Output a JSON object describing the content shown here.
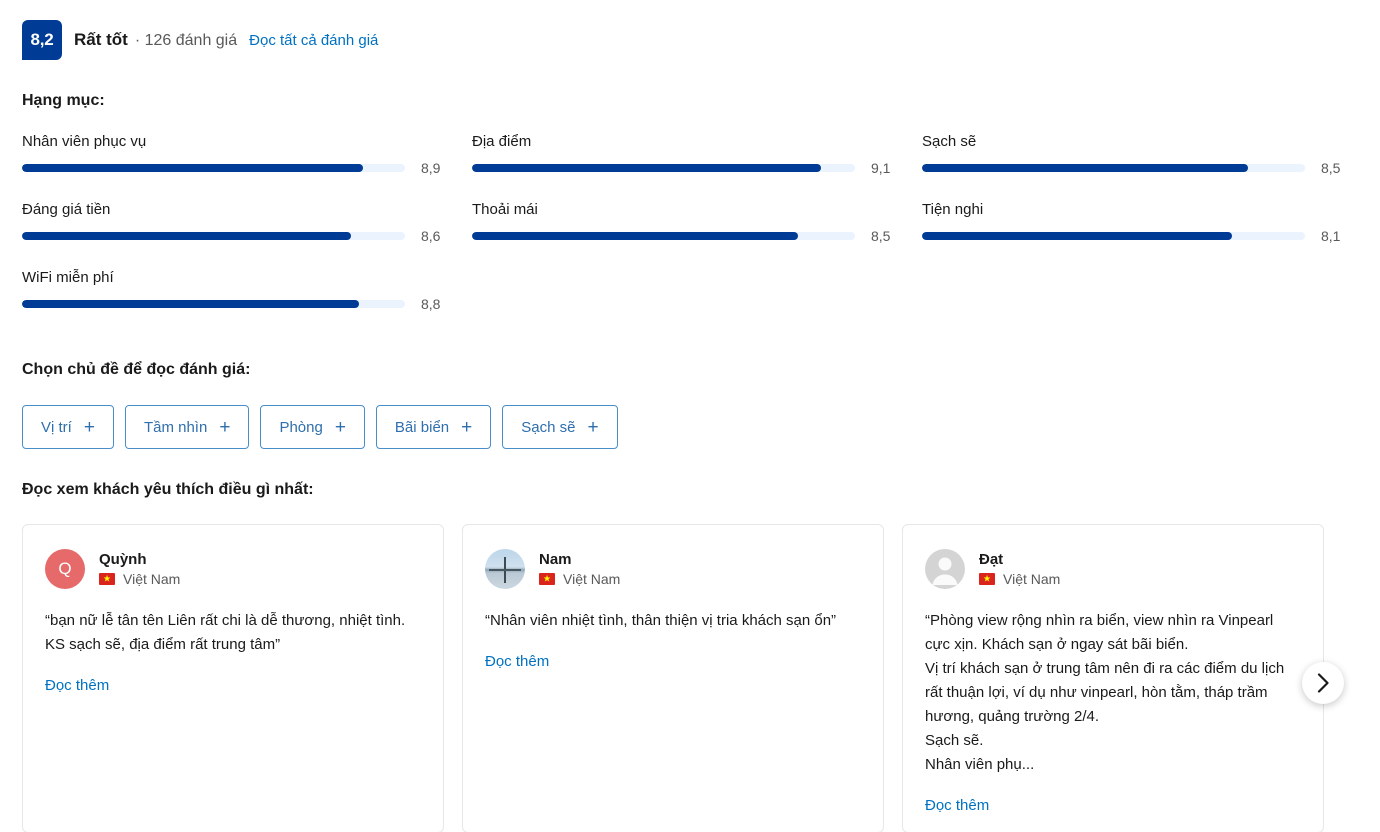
{
  "header": {
    "score": "8,2",
    "score_word": "Rất tốt",
    "review_count": "· 126 đánh giá",
    "all_reviews_link": "Đọc tất cả đánh giá",
    "badge_color": "#003b95",
    "link_color": "#0071c2"
  },
  "categories": {
    "title": "Hạng mục:",
    "bar_fill_color": "#003b95",
    "bar_track_color": "#ebf3ff",
    "items": [
      {
        "label": "Nhân viên phục vụ",
        "score": "8,9",
        "pct": 89
      },
      {
        "label": "Địa điểm",
        "score": "9,1",
        "pct": 91
      },
      {
        "label": "Sạch sẽ",
        "score": "8,5",
        "pct": 85
      },
      {
        "label": "Đáng giá tiền",
        "score": "8,6",
        "pct": 86
      },
      {
        "label": "Thoải mái",
        "score": "8,5",
        "pct": 85
      },
      {
        "label": "Tiện nghi",
        "score": "8,1",
        "pct": 81
      },
      {
        "label": "WiFi miễn phí",
        "score": "8,8",
        "pct": 88
      }
    ]
  },
  "topics": {
    "title": "Chọn chủ đề để đọc đánh giá:",
    "plus_glyph": "+",
    "items": [
      {
        "label": "Vị trí"
      },
      {
        "label": "Tầm nhìn"
      },
      {
        "label": "Phòng"
      },
      {
        "label": "Bãi biển"
      },
      {
        "label": "Sạch sẽ"
      }
    ]
  },
  "reviews": {
    "title": "Đọc xem khách yêu thích điều gì nhất:",
    "read_more_label": "Đọc thêm",
    "country_label": "Việt Nam",
    "next_label": "›",
    "cards": [
      {
        "name": "Quỳnh",
        "avatar_type": "initial",
        "avatar_initial": "Q",
        "avatar_color": "#e76a6a",
        "country": "Việt Nam",
        "text": "“bạn nữ lễ tân tên Liên rất chi là dễ thương, nhiệt tình. KS sạch sẽ, địa điểm rất trung tâm”",
        "read_more": "Đọc thêm"
      },
      {
        "name": "Nam",
        "avatar_type": "photo",
        "avatar_initial": "",
        "avatar_color": "#bcd6ea",
        "country": "Việt Nam",
        "text": "“Nhân viên nhiệt tình, thân thiện vị tria khách sạn ổn”",
        "read_more": "Đọc thêm"
      },
      {
        "name": "Đạt",
        "avatar_type": "placeholder",
        "avatar_initial": "",
        "avatar_color": "#d4d4d4",
        "country": "Việt Nam",
        "text": "“Phòng view rộng nhìn ra biển, view nhìn ra Vinpearl cực xịn. Khách sạn ở ngay sát bãi biển.\nVị trí khách sạn ở trung tâm nên đi ra các điểm du lịch rất thuận lợi, ví dụ như vinpearl, hòn tằm, tháp trầm hương, quảng trường 2/4.\nSạch sẽ.\nNhân viên phụ...",
        "read_more": "Đọc thêm"
      }
    ]
  }
}
